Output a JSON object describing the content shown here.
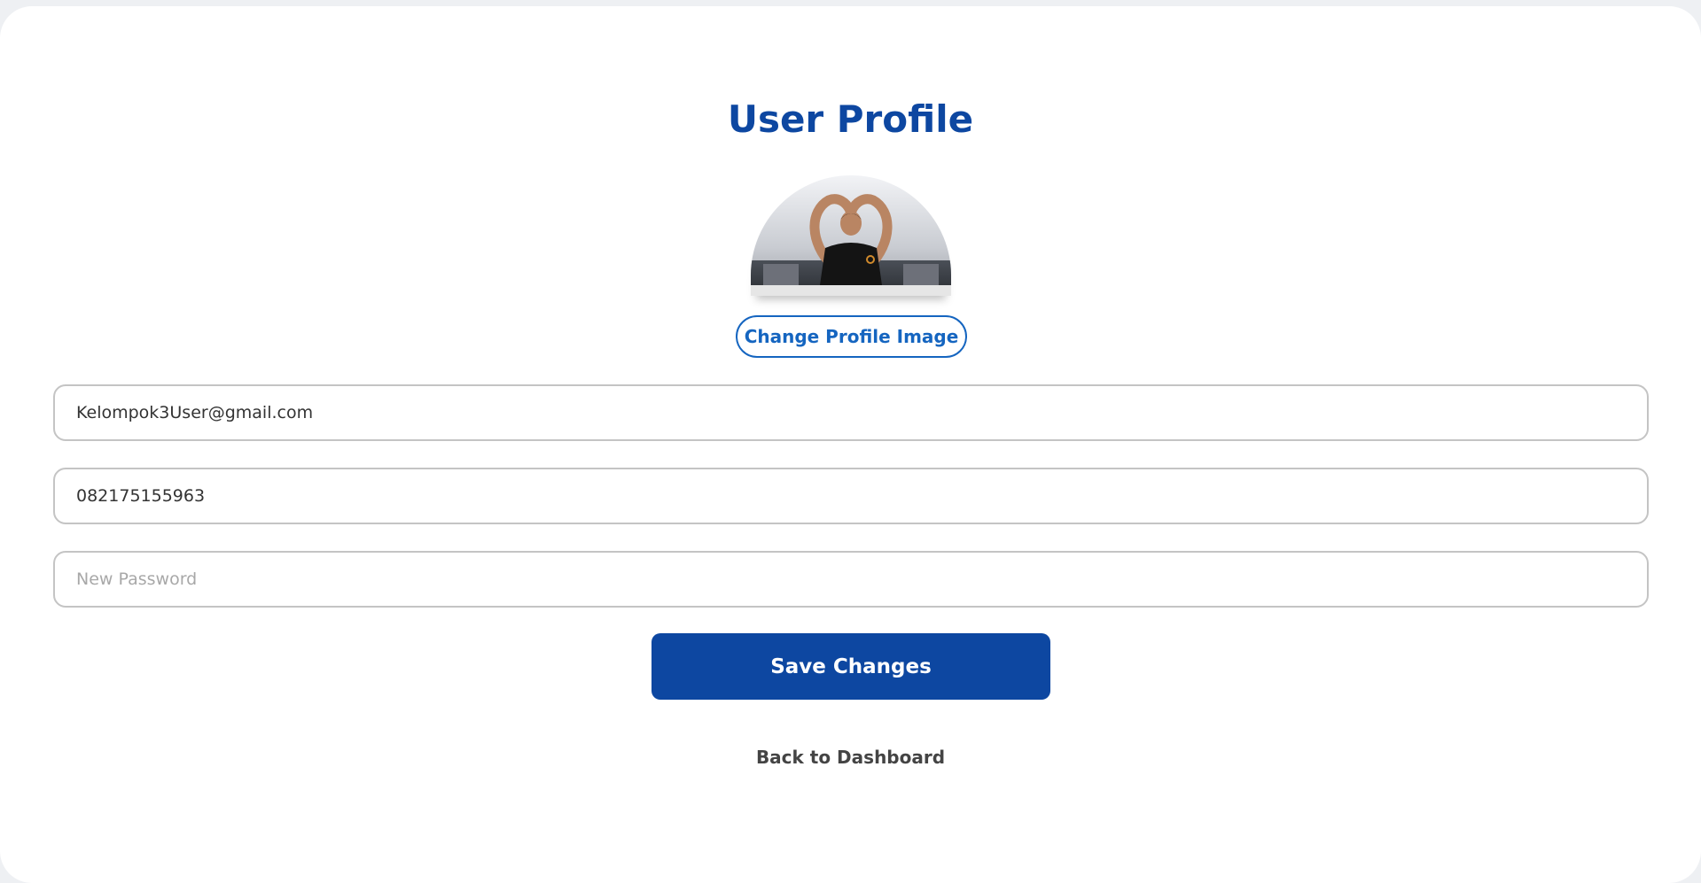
{
  "page": {
    "title": "User Profile"
  },
  "profile_image": {
    "alt": "Profile photo of a man making a heart shape with his arms above his head"
  },
  "buttons": {
    "change_image": "Change Profile Image",
    "save": "Save Changes"
  },
  "form": {
    "email_value": "Kelompok3User@gmail.com",
    "phone_value": "082175155963",
    "password_value": "",
    "password_placeholder": "New Password"
  },
  "links": {
    "back": "Back to Dashboard"
  },
  "colors": {
    "accent": "#0d47a1",
    "link_blue": "#1565c0",
    "background": "#eef0f3"
  }
}
